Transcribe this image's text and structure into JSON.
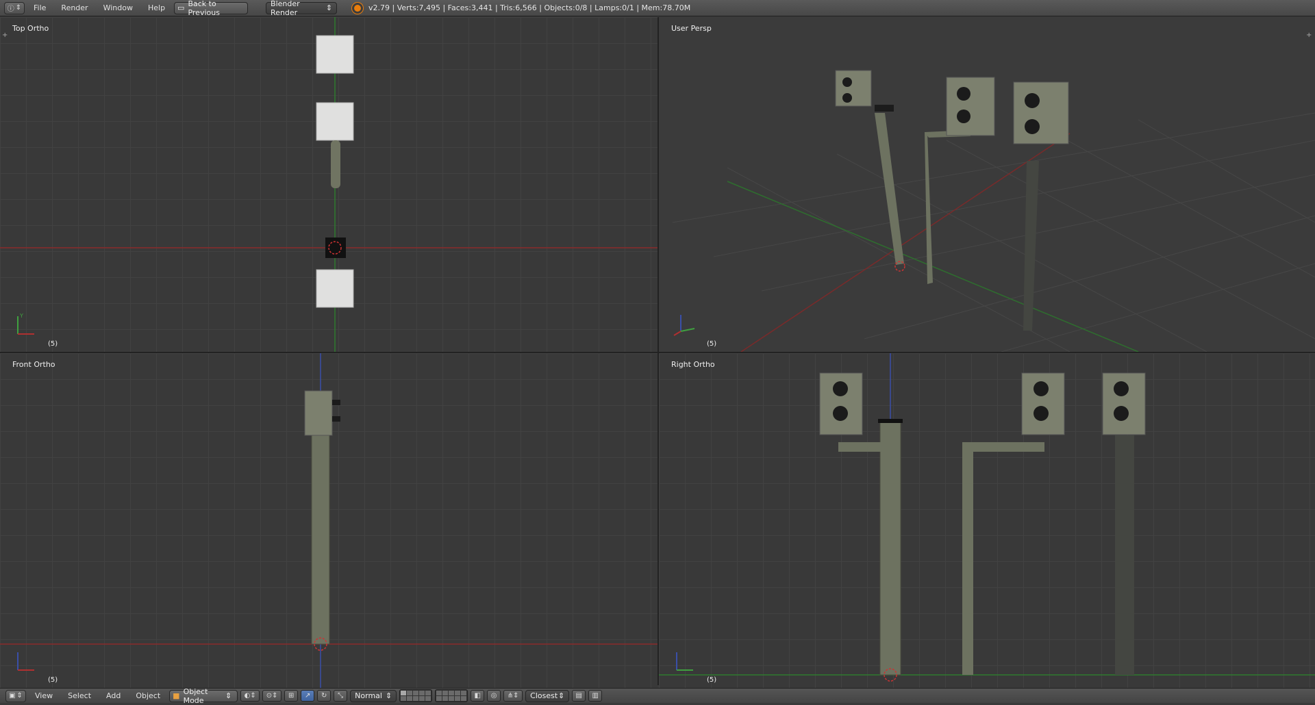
{
  "topbar": {
    "menus": [
      "File",
      "Render",
      "Window",
      "Help"
    ],
    "back_button": "Back to Previous",
    "render_engine": "Blender Render",
    "stats": "v2.79 | Verts:7,495 | Faces:3,441 | Tris:6,566 | Objects:0/8 | Lamps:0/1 | Mem:78.70M"
  },
  "viewports": {
    "top_left": {
      "label": "Top Ortho",
      "frame": "(5)"
    },
    "top_right": {
      "label": "User Persp",
      "frame": "(5)"
    },
    "bottom_left": {
      "label": "Front Ortho",
      "frame": "(5)"
    },
    "bottom_right": {
      "label": "Right Ortho",
      "frame": "(5)"
    }
  },
  "bottombar": {
    "menus": [
      "View",
      "Select",
      "Add",
      "Object"
    ],
    "mode": "Object Mode",
    "orientation": "Normal",
    "snap": "Closest"
  },
  "colors": {
    "x_axis": "#8b2a2a",
    "y_axis": "#2f7a2f",
    "z_axis": "#3a4fa8",
    "accent": "#e87d0d"
  }
}
